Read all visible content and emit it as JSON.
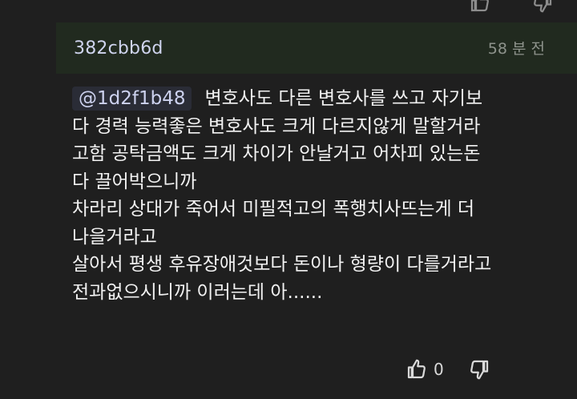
{
  "comment": {
    "username": "382cbb6d",
    "timestamp": "58 분 전",
    "mention": "@1d2f1b48",
    "lines": [
      "변호사도 다른 변호사를 쓰고 자기보",
      "다 경력 능력좋은 변호사도 크게 다르지않게 말할거라",
      "고함 공탁금액도 크게 차이가 안날거고 어차피 있는돈",
      "다 끌어박으니까",
      "차라리 상대가 죽어서 미필적고의 폭행치사뜨는게 더",
      "나을거라고",
      "살아서 평생 후유장애것보다 돈이나 형량이 다를거라고",
      "전과없으시니까 이러는데 아......"
    ],
    "like_count": "0"
  },
  "colors": {
    "background": "#1f1f1f",
    "header_background": "#212a1f",
    "username": "#cfd4ee",
    "text": "#f2f2f2"
  }
}
